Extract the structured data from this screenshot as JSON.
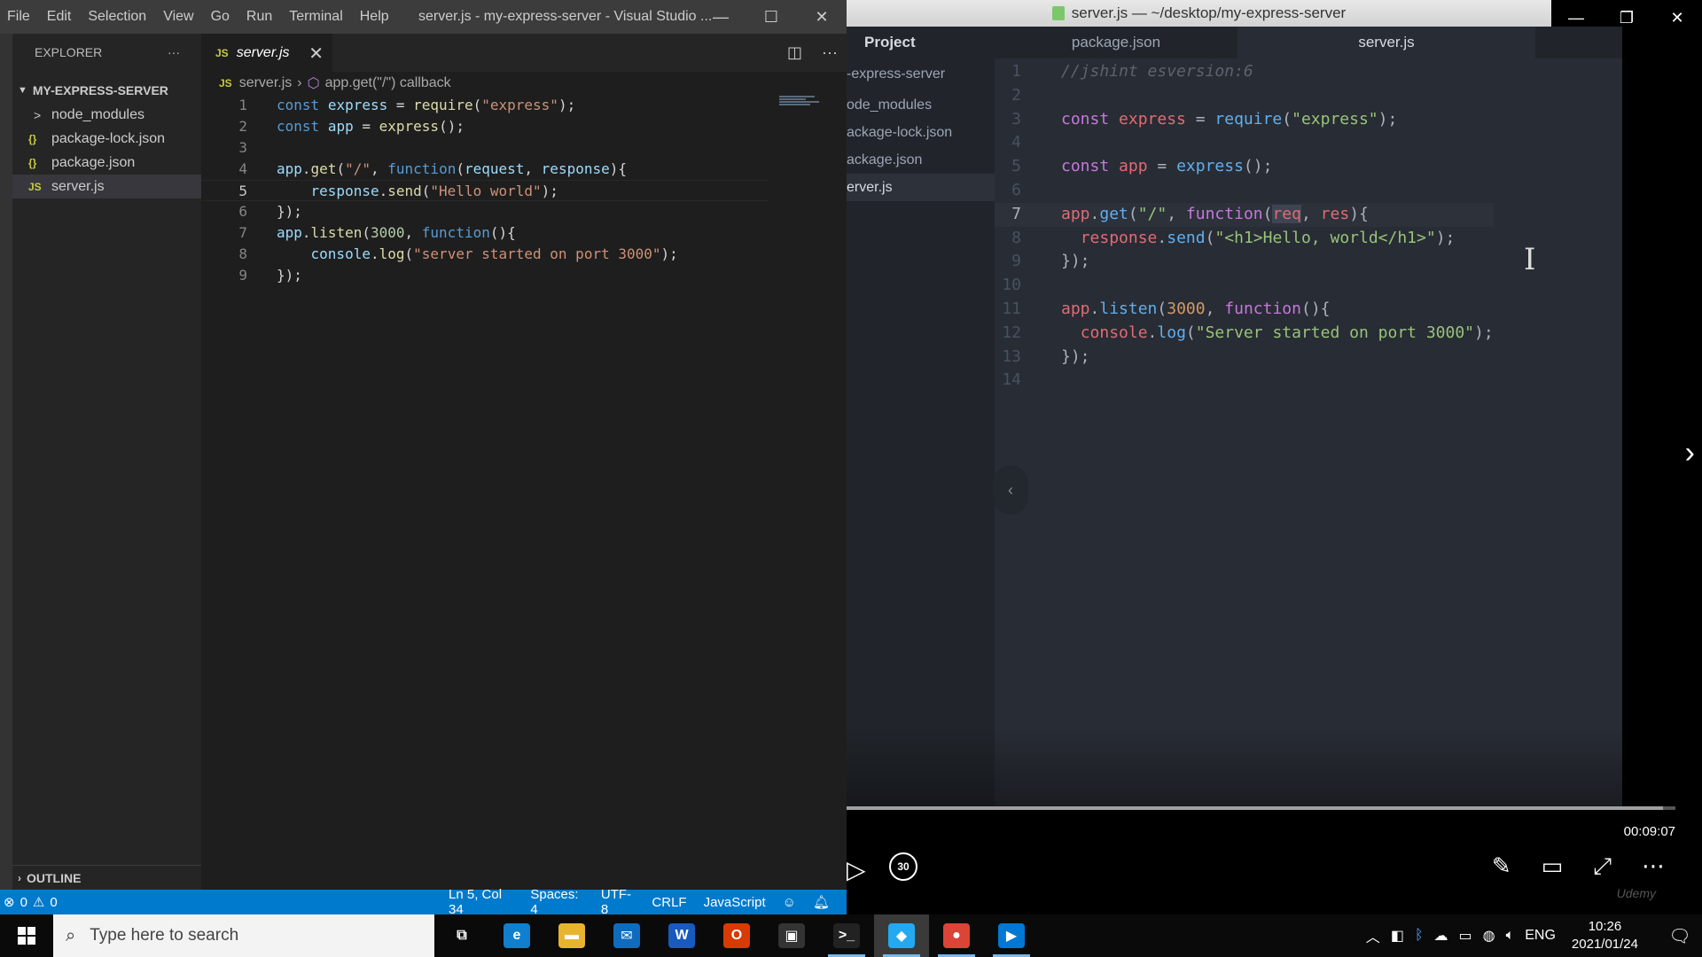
{
  "vscode": {
    "menu": [
      "File",
      "Edit",
      "Selection",
      "View",
      "Go",
      "Run",
      "Terminal",
      "Help"
    ],
    "window_title": "server.js - my-express-server - Visual Studio ...",
    "explorer_label": "EXPLORER",
    "more_glyph": "···",
    "folder_name": "MY-EXPRESS-SERVER",
    "files": [
      {
        "icon": ">",
        "name": "node_modules"
      },
      {
        "icon": "{}",
        "name": "package-lock.json"
      },
      {
        "icon": "{}",
        "name": "package.json"
      },
      {
        "icon": "JS",
        "name": "server.js"
      }
    ],
    "outline_label": "OUTLINE",
    "tab": {
      "icon": "JS",
      "label": "server.js"
    },
    "breadcrumb": {
      "file": "server.js",
      "symbol": "app.get(\"/\") callback"
    },
    "code_lines": [
      "const express = require(\"express\");",
      "const app = express();",
      "",
      "app.get(\"/\", function(request, response){",
      "    response.send(\"Hello world\");",
      "});",
      "app.listen(3000, function(){",
      "    console.log(\"server started on port 3000\");",
      "});"
    ],
    "current_line": 5,
    "status": {
      "problems": "0",
      "position": "Ln 5, Col 34",
      "spaces": "Spaces: 4",
      "encoding": "UTF-8",
      "eol": "CRLF",
      "language": "JavaScript"
    }
  },
  "video": {
    "atom_title": "server.js — ~/desktop/my-express-server",
    "tree_head": "Project",
    "tree_items": [
      "-express-server",
      "ode_modules",
      "ackage-lock.json",
      "ackage.json",
      "erver.js"
    ],
    "tabs": [
      "package.json",
      "server.js"
    ],
    "code_lines": [
      "//jshint esversion:6",
      "",
      "const express = require(\"express\");",
      "",
      "const app = express();",
      "",
      "app.get(\"/\", function(req, res){",
      "  response.send(\"<h1>Hello, world</h1>\");",
      "});",
      "",
      "app.listen(3000, function(){",
      "  console.log(\"Server started on port 3000\");",
      "});",
      ""
    ],
    "current_line": 7,
    "time": "00:09:07",
    "skip_seconds": "30",
    "progress_fraction": 0.985,
    "watermark": "Udemy"
  },
  "taskbar": {
    "search_placeholder": "Type here to search",
    "apps": [
      {
        "name": "task-view",
        "glyph": "⧉",
        "color": "#0a0a0a",
        "running": false
      },
      {
        "name": "edge",
        "glyph": "e",
        "color": "#0f7fce",
        "running": false
      },
      {
        "name": "file-explorer",
        "glyph": "▬",
        "color": "#e8b430",
        "running": false
      },
      {
        "name": "mail",
        "glyph": "✉",
        "color": "#0f6cbd",
        "running": false
      },
      {
        "name": "word",
        "glyph": "W",
        "color": "#185abd",
        "running": false
      },
      {
        "name": "office",
        "glyph": "O",
        "color": "#d83b01",
        "running": false
      },
      {
        "name": "store",
        "glyph": "▣",
        "color": "#333333",
        "running": false
      },
      {
        "name": "terminal",
        "glyph": ">_",
        "color": "#222222",
        "running": true
      },
      {
        "name": "vscode",
        "glyph": "◆",
        "color": "#23a9f2",
        "running": true
      },
      {
        "name": "chrome",
        "glyph": "●",
        "color": "#db4437",
        "running": true
      },
      {
        "name": "movies",
        "glyph": "▶",
        "color": "#0078d4",
        "running": true
      }
    ],
    "language": "ENG",
    "time": "10:26",
    "date": "2021/01/24"
  }
}
